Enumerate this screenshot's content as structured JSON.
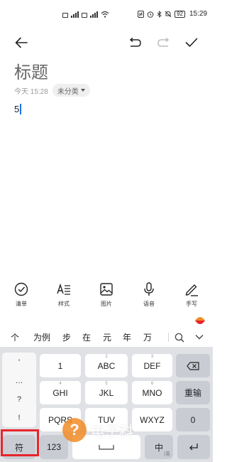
{
  "status_bar": {
    "battery": "92",
    "time": "15:29"
  },
  "editor": {
    "title": "标题",
    "timestamp": "今天 15:28",
    "category": "未分类",
    "content": "5"
  },
  "format_bar": {
    "items": [
      {
        "label": "清单",
        "icon": "checklist-icon"
      },
      {
        "label": "样式",
        "icon": "text-style-icon"
      },
      {
        "label": "图片",
        "icon": "image-icon"
      },
      {
        "label": "语音",
        "icon": "microphone-icon"
      },
      {
        "label": "手写",
        "icon": "pen-icon"
      }
    ]
  },
  "candidates": [
    "个",
    "为例",
    "步",
    "在",
    "元",
    "年",
    "万"
  ],
  "keyboard": {
    "symbols": [
      "'",
      "…",
      "?",
      "!"
    ],
    "keys": {
      "k1": "1",
      "abc": "ABC",
      "def": "DEF",
      "ghi": "GHI",
      "jkl": "JKL",
      "mno": "MNO",
      "pqrs": "PQRS",
      "tuv": "TUV",
      "wxyz": "WXYZ",
      "k0": "0",
      "fu": "符",
      "num": "123",
      "zhong": "中",
      "chongshu": "重输"
    },
    "hints": {
      "abc": "2",
      "def": "3",
      "ghi": "4",
      "jkl": "5",
      "mno": "6",
      "zhong": "/英"
    }
  },
  "watermark": {
    "text": "电子科"
  }
}
